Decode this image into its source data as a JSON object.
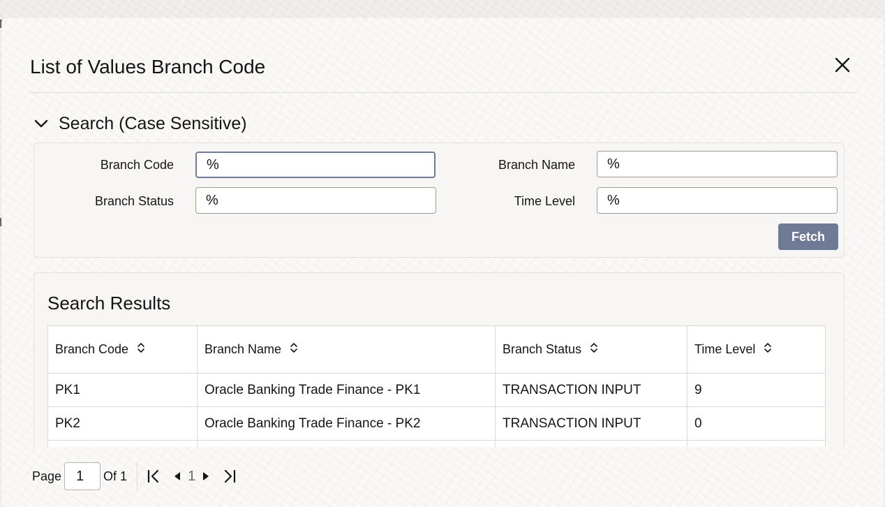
{
  "dialog": {
    "title": "List of Values Branch Code"
  },
  "search": {
    "section_label": "Search (Case Sensitive)",
    "fields": {
      "branch_code": {
        "label": "Branch Code",
        "value": "%"
      },
      "branch_name": {
        "label": "Branch Name",
        "value": "%"
      },
      "branch_status": {
        "label": "Branch Status",
        "value": "%"
      },
      "time_level": {
        "label": "Time Level",
        "value": "%"
      }
    },
    "fetch_label": "Fetch"
  },
  "results": {
    "title": "Search Results",
    "columns": [
      "Branch Code",
      "Branch Name",
      "Branch Status",
      "Time Level"
    ],
    "rows": [
      [
        "PK1",
        "Oracle Banking Trade Finance - PK1",
        "TRANSACTION INPUT",
        "9"
      ],
      [
        "PK2",
        "Oracle Banking Trade Finance - PK2",
        "TRANSACTION INPUT",
        "0"
      ]
    ]
  },
  "pagination": {
    "page_label": "Page",
    "current_page": "1",
    "of_label": "Of 1",
    "page_number": "1"
  },
  "colors": {
    "accent": "#6f7a94",
    "text": "#161513",
    "border": "#dcd9d4"
  },
  "icons": [
    "close-icon",
    "chevron-down-icon",
    "sort-icon",
    "first-page-icon",
    "previous-page-icon",
    "next-page-icon",
    "last-page-icon"
  ]
}
